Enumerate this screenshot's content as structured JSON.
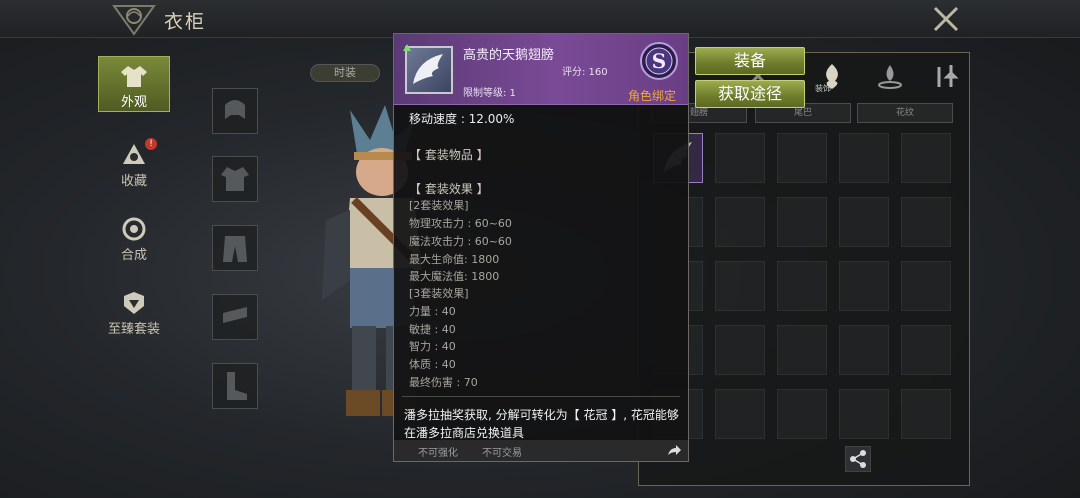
{
  "header": {
    "title": "衣柜"
  },
  "side_tabs": [
    {
      "label": "外观",
      "icon": "outfit-icon"
    },
    {
      "label": "收藏",
      "icon": "collection-icon"
    },
    {
      "label": "合成",
      "icon": "synthesis-icon"
    },
    {
      "label": "至臻套装",
      "icon": "premium-set-icon"
    }
  ],
  "filter_pill": "时装",
  "right_panel": {
    "category_label": "装饰",
    "sub_tabs": [
      "翅膀",
      "尾巴",
      "花纹"
    ]
  },
  "tooltip": {
    "item_name": "高贵的天鹅翅膀",
    "score_label": "评分: 160",
    "level_label": "限制等级: 1",
    "grade": "S",
    "bind_label": "角色绑定",
    "move_speed": "移动速度 : 12.00%",
    "set_items_header": "【 套装物品 】",
    "set_effect_header": "【 套装效果 】",
    "set2_header": "[2套装效果]",
    "set2_lines": [
      "物理攻击力 : 60~60",
      "魔法攻击力 : 60~60",
      "最大生命值:   1800",
      "最大魔法值:   1800"
    ],
    "set3_header": "[3套装效果]",
    "set3_lines": [
      "力量 : 40",
      "敏捷 : 40",
      "智力 : 40",
      "体质 : 40",
      "最终伤害 : 70"
    ],
    "description": "潘多拉抽奖获取, 分解可转化为【 花冠 】, 花冠能够在潘多拉商店兑换道具",
    "footer_left": "不可强化",
    "footer_right": "不可交易"
  },
  "buttons": {
    "equip": "装备",
    "obtain": "获取途径"
  },
  "colors": {
    "header_purple": "#7a4a96",
    "bind_orange": "#f0a83a",
    "button_green": "#7e8c35",
    "active_tab_green": "#6a7a30"
  },
  "badge_count": "!"
}
